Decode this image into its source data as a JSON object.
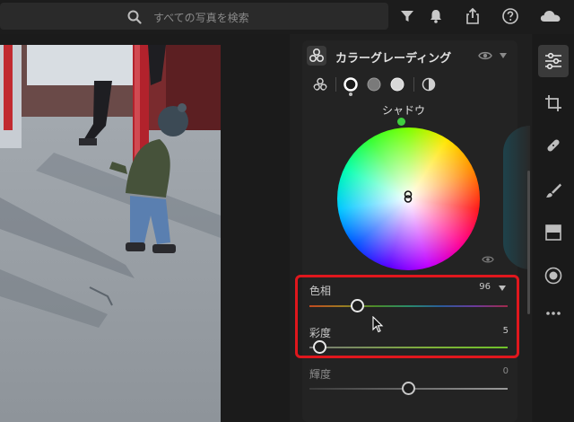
{
  "app": {
    "search": {
      "placeholder": "すべての写真を検索"
    },
    "toolbar_icons": [
      "search-icon",
      "filter-icon",
      "bell-icon",
      "share-icon",
      "help-icon",
      "cloud-icon"
    ]
  },
  "panel": {
    "title": "カラーグレーディング",
    "modes": [
      "three-way-icon",
      "shadows-icon",
      "midtones-icon",
      "highlights-icon",
      "global-icon"
    ],
    "wheel": {
      "label": "シャドウ",
      "knob_color": "#3fcf3f"
    },
    "sliders": [
      {
        "label": "色相",
        "value": "96",
        "fraction": 0.24,
        "highlighted": true
      },
      {
        "label": "彩度",
        "value": "5",
        "fraction": 0.05,
        "highlighted": true
      },
      {
        "label": "輝度",
        "value": "0",
        "fraction": 0.5,
        "highlighted": false
      }
    ]
  },
  "right_rail": [
    "edit-sliders-icon",
    "crop-icon",
    "healing-icon",
    "brush-icon",
    "linear-gradient-icon",
    "radial-gradient-icon",
    "more-icon"
  ],
  "colors": {
    "highlight_box": "#e0171d",
    "accent_green": "#3fcf3f"
  }
}
